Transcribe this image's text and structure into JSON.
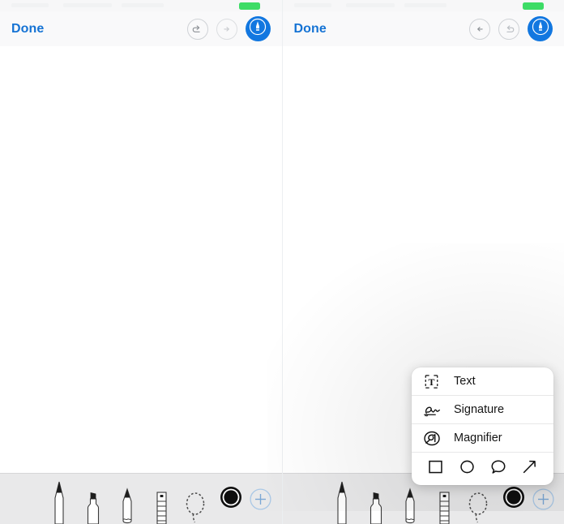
{
  "app": {
    "title": "Markup Editor",
    "accent_blue": "#1277e0",
    "done_blue": "#1573d4",
    "toolbar_bg": "#e9e9ea",
    "navbar_bg": "#f9f9fa",
    "canvas_bg": "#ffffff",
    "battery_green": "#3ddc66"
  },
  "panels": [
    {
      "id": "left",
      "status": {
        "battery_icon": "battery-full-icon"
      },
      "navbar": {
        "done_label": "Done",
        "undo": {
          "icon": "undo-arrow-icon",
          "enabled": true
        },
        "redo": {
          "icon": "redo-arrow-icon",
          "enabled": false
        },
        "markup": {
          "icon": "pen-markup-icon",
          "active": true
        }
      },
      "toolbar": {
        "tools": [
          {
            "name": "pen-tool",
            "icon": "pen-icon",
            "selected": false
          },
          {
            "name": "highlighter-tool",
            "icon": "highlighter-icon",
            "selected": false
          },
          {
            "name": "pencil-tool",
            "icon": "pencil-icon",
            "selected": false
          },
          {
            "name": "eraser-tool",
            "icon": "eraser-icon",
            "selected": false
          },
          {
            "name": "lasso-tool",
            "icon": "lasso-icon",
            "selected": false
          }
        ],
        "color_swatch": {
          "name": "color-swatch",
          "color": "#000000"
        },
        "add_button": {
          "name": "add-button",
          "icon": "plus-circle-icon"
        }
      }
    },
    {
      "id": "right",
      "status": {
        "battery_icon": "battery-full-icon"
      },
      "navbar": {
        "done_label": "Done",
        "undo": {
          "icon": "undo-arrow-icon",
          "enabled": true
        },
        "redo": {
          "icon": "redo-arrow-icon",
          "enabled": true
        },
        "markup": {
          "icon": "pen-markup-icon",
          "active": true
        }
      },
      "toolbar": {
        "tools": [
          {
            "name": "pen-tool",
            "icon": "pen-icon",
            "selected": false
          },
          {
            "name": "highlighter-tool",
            "icon": "highlighter-icon",
            "selected": false
          },
          {
            "name": "pencil-tool",
            "icon": "pencil-icon",
            "selected": false
          },
          {
            "name": "eraser-tool",
            "icon": "eraser-icon",
            "selected": false
          },
          {
            "name": "lasso-tool",
            "icon": "lasso-icon",
            "selected": false
          }
        ],
        "color_swatch": {
          "name": "color-swatch",
          "color": "#000000"
        },
        "add_button": {
          "name": "add-button",
          "icon": "plus-circle-icon"
        }
      }
    }
  ],
  "popup_menu": {
    "items": [
      {
        "label": "Text",
        "icon": "text-box-icon"
      },
      {
        "label": "Signature",
        "icon": "signature-icon"
      },
      {
        "label": "Magnifier",
        "icon": "magnifier-icon"
      }
    ],
    "shapes": [
      {
        "name": "square-shape",
        "icon": "square-icon"
      },
      {
        "name": "circle-shape",
        "icon": "circle-icon"
      },
      {
        "name": "speech-bubble-shape",
        "icon": "speech-bubble-icon"
      },
      {
        "name": "arrow-shape",
        "icon": "arrow-icon"
      }
    ]
  }
}
